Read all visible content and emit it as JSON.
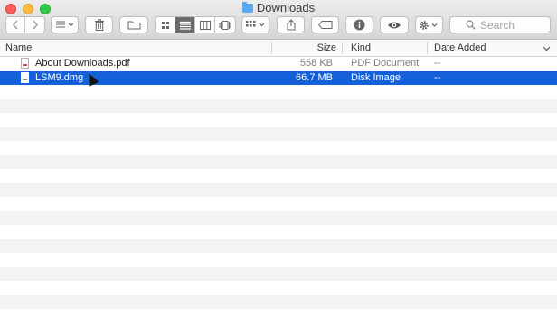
{
  "window": {
    "title": "Downloads"
  },
  "toolbar": {
    "back_icon": "chevron-left-icon",
    "forward_icon": "chevron-right-icon",
    "arrange_icon": "list-dropdown-icon",
    "trash_icon": "trash-icon",
    "new_folder_icon": "folder-icon",
    "view_modes": [
      "icon-view-icon",
      "list-view-icon",
      "column-view-icon",
      "coverflow-view-icon"
    ],
    "group_icon": "grid-dropdown-icon",
    "share_icon": "share-icon",
    "tag_icon": "tag-icon",
    "info_icon": "info-icon",
    "quicklook_icon": "eye-icon",
    "action_icon": "gear-icon",
    "search_placeholder": "Search"
  },
  "columns": {
    "name": "Name",
    "size": "Size",
    "kind": "Kind",
    "date_added": "Date Added"
  },
  "files": [
    {
      "name": "About Downloads.pdf",
      "size": "558 KB",
      "kind": "PDF Document",
      "date_added": "--"
    },
    {
      "name": "LSM9.dmg",
      "size": "66.7 MB",
      "kind": "Disk Image",
      "date_added": "--"
    }
  ],
  "colors": {
    "selection": "#1360d8"
  }
}
